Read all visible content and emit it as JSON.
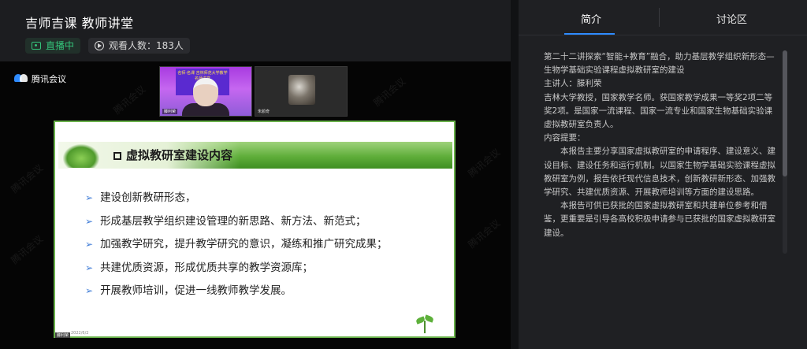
{
  "header": {
    "title": "吉师吉课 教师讲堂",
    "live_label": "直播中",
    "viewers_label": "观看人数：183人"
  },
  "meeting": {
    "app_name": "腾讯会议",
    "watermark": "腾讯会议",
    "participants": [
      {
        "name": "滕利荣",
        "banner": "名师·名课 吉林师范大学教学名师讲堂"
      },
      {
        "name": "朱颜奇"
      }
    ],
    "slide": {
      "title": "虚拟教研室建设内容",
      "bullets": [
        "建设创新教研形态，",
        "形成基层教学组织建设管理的新思路、新方法、新范式；",
        "加强教学研究，提升教学研究的意识，凝练和推广研究成果；",
        "共建优质资源，形成优质共享的教学资源库；",
        "开展教师培训，促进一线教师教学发展。"
      ],
      "date": "2022/6/2",
      "speaker": "滕利荣"
    }
  },
  "panel": {
    "tabs": [
      {
        "label": "简介",
        "active": true
      },
      {
        "label": "讨论区",
        "active": false
      }
    ],
    "intro": {
      "p1": "第二十二讲探索“智能+教育”融合，助力基层教学组织新形态—生物学基础实验课程虚拟教研室的建设",
      "p2": "主讲人：滕利荣",
      "p3": "吉林大学教授，国家教学名师。获国家教学成果一等奖2项二等奖2项。是国家一流课程、国家一流专业和国家生物基础实验课虚拟教研室负责人。",
      "p4": "内容提要：",
      "p5": "本报告主要分享国家虚拟教研室的申请程序、建设意义、建设目标、建设任务和运行机制。以国家生物学基础实验课程虚拟教研室为例，报告依托现代信息技术，创新教研新形态、加强教学研究、共建优质资源、开展教师培训等方面的建设思路。",
      "p6": "本报告可供已获批的国家虚拟教研室和共建单位参考和借鉴，更重要是引导各高校积极申请参与已获批的国家虚拟教研室建设。"
    }
  },
  "colors": {
    "accent": "#2e8bff",
    "live": "#34c37a",
    "slide_header": "#5fae3a"
  }
}
